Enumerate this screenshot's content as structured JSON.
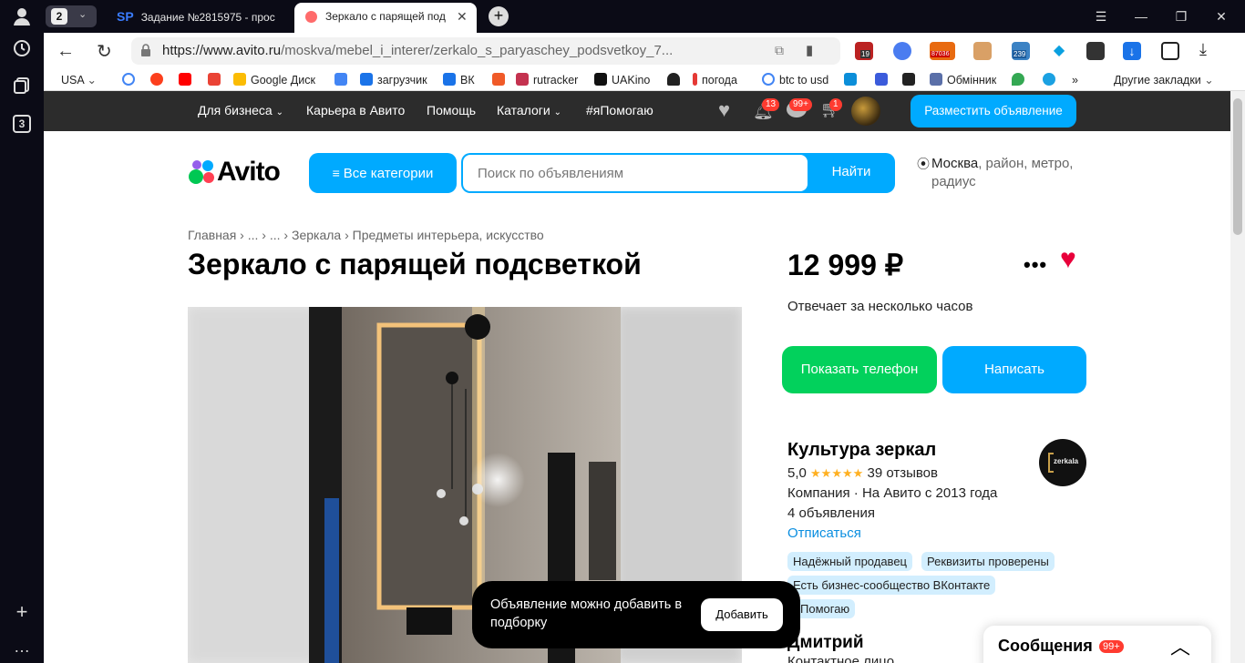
{
  "sidebar": {
    "tab_count_badge": "3"
  },
  "tabs": {
    "group_count": "2",
    "items": [
      {
        "favicon": "SP",
        "label": "Задание №2815975 - прос"
      },
      {
        "label": "Зеркало с парящей под"
      }
    ]
  },
  "address": {
    "domain": "https://www.avito.ru",
    "path": "/moskva/mebel_i_interer/zerkalo_s_paryaschey_podsvetkoy_7..."
  },
  "extensions": {
    "badge_19": "19",
    "badge_87": "87036",
    "badge_239": "239"
  },
  "bookmarks": {
    "items": [
      "USA",
      "Google Диск",
      "загрузчик",
      "ВК",
      "rutracker",
      "UAKino",
      "погода",
      "btc to usd",
      "Обмінник"
    ],
    "more": "»",
    "other": "Другие закладки"
  },
  "site_nav": {
    "links": [
      "Для бизнеса",
      "Карьера в Авито",
      "Помощь",
      "Каталоги",
      "#яПомогаю"
    ],
    "notif_badge": "13",
    "msg_badge": "99+",
    "cart_badge": "1",
    "post_button": "Разместить объявление"
  },
  "header": {
    "logo_text": "Avito",
    "categories_button": "Все категории",
    "search_placeholder": "Поиск по объявлениям",
    "search_button": "Найти",
    "location_city": "Москва",
    "location_rest": ", район, метро, радиус"
  },
  "listing": {
    "breadcrumb": [
      "Главная",
      "...",
      "...",
      "Зеркала",
      "Предметы интерьера, искусство"
    ],
    "title": "Зеркало с парящей подсветкой",
    "price": "12 999 ₽",
    "responds": "Отвечает за несколько часов",
    "show_phone": "Показать телефон",
    "write": "Написать"
  },
  "seller": {
    "name": "Культура зеркал",
    "rating": "5,0",
    "stars": "★★★★★",
    "reviews": "39 отзывов",
    "company": "Компания · На Авито с 2013 года",
    "ads": "4 объявления",
    "unsubscribe": "Отписаться",
    "avatar_text": "zerkala",
    "tags": [
      "Надёжный продавец",
      "Реквизиты проверены",
      "Есть бизнес-сообщество ВКонтакте",
      "Помогаю"
    ],
    "contact_name": "Дмитрий",
    "contact_role": "Контактное лицо"
  },
  "toast": {
    "text": "Объявление можно добавить в подборку",
    "button": "Добавить"
  },
  "messages": {
    "label": "Сообщения",
    "badge": "99+"
  }
}
